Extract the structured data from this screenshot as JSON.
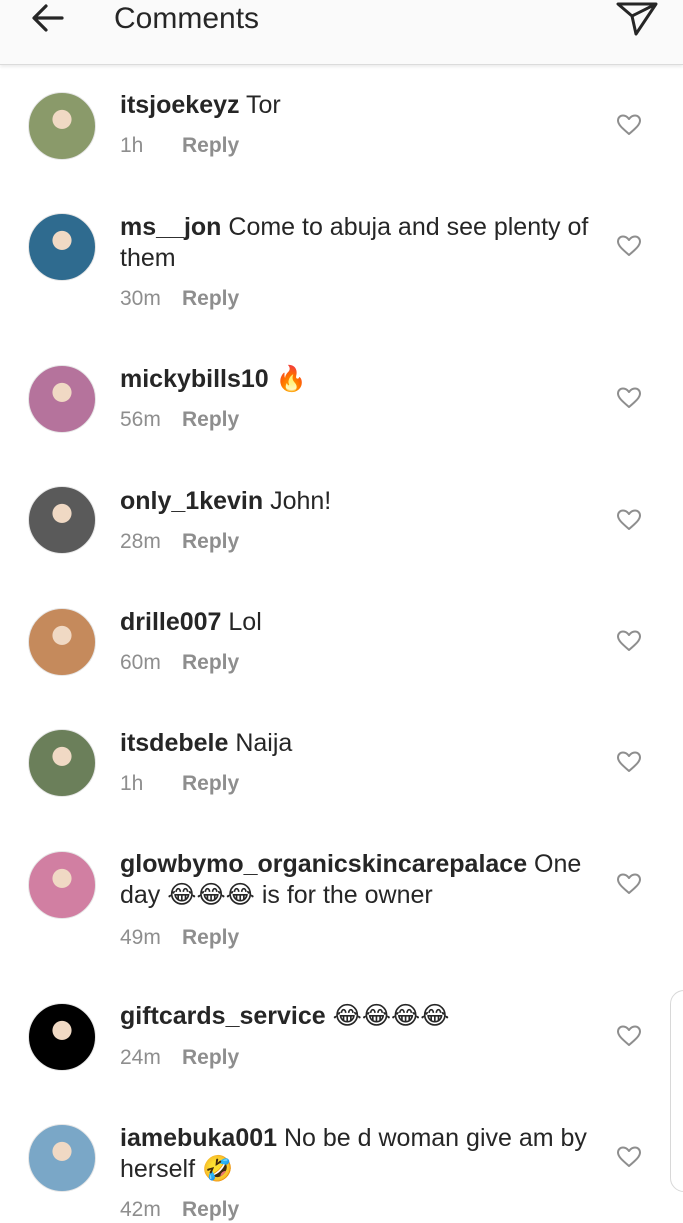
{
  "header": {
    "title": "Comments",
    "back_icon": "arrow-left-icon",
    "send_icon": "paper-plane-icon"
  },
  "reply_label": "Reply",
  "comments": [
    {
      "user": "itsjoekeyz",
      "text": " Tor",
      "time": "1h",
      "avatar_color": "#8a9a6a"
    },
    {
      "user": "ms__jon",
      "text": " Come to abuja and see plenty of them",
      "time": "30m",
      "avatar_color": "#2f6b8f"
    },
    {
      "user": "mickybills10",
      "text": " 🔥",
      "time": "56m",
      "avatar_color": "#b5739c"
    },
    {
      "user": "only_1kevin",
      "text": " John!",
      "time": "28m",
      "avatar_color": "#5a5a5a"
    },
    {
      "user": "drille007",
      "text": " Lol",
      "time": "60m",
      "avatar_color": "#c58a5c"
    },
    {
      "user": "itsdebele",
      "text": " Naija",
      "time": "1h",
      "avatar_color": "#6b7f5a"
    },
    {
      "user": "glowbymo_organicskincarepalace",
      "text": " One day 😂😂😂 is for the owner",
      "time": "49m",
      "avatar_color": "#d17fa2"
    },
    {
      "user": "giftcards_service",
      "text": " 😂😂😂😂",
      "time": "24m",
      "avatar_color": "#000000"
    },
    {
      "user": "iamebuka001",
      "text": " No be d woman give am by herself 🤣",
      "time": "42m",
      "avatar_color": "#7aa7c7"
    }
  ]
}
